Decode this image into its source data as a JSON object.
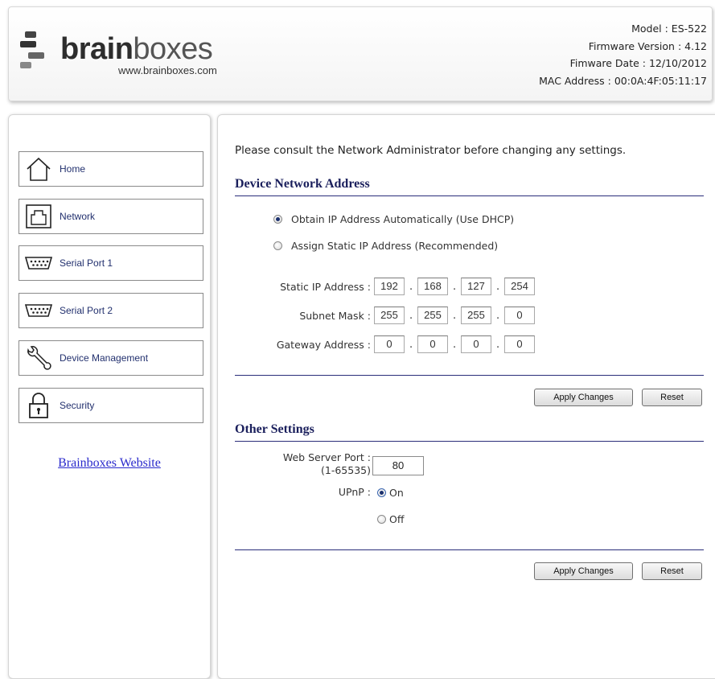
{
  "header": {
    "logo": {
      "brand_bold": "brain",
      "brand_light": "boxes",
      "url": "www.brainboxes.com"
    },
    "device_info": [
      {
        "label": "Model :",
        "value": "ES-522"
      },
      {
        "label": "Firmware Version :",
        "value": "4.12"
      },
      {
        "label": "Fimware Date :",
        "value": "12/10/2012"
      },
      {
        "label": "MAC Address :",
        "value": "00:0A:4F:05:11:17"
      }
    ]
  },
  "sidebar": {
    "items": [
      {
        "label": "Home",
        "icon": "home-icon"
      },
      {
        "label": "Network",
        "icon": "network-port-icon"
      },
      {
        "label": "Serial Port 1",
        "icon": "serial-port-icon"
      },
      {
        "label": "Serial Port 2",
        "icon": "serial-port-icon"
      },
      {
        "label": "Device Management",
        "icon": "wrench-icon"
      },
      {
        "label": "Security",
        "icon": "padlock-icon"
      }
    ],
    "website_link": "Brainboxes Website"
  },
  "main": {
    "notice": "Please consult the Network Administrator before changing any settings.",
    "network": {
      "title": "Device Network Address",
      "dhcp_label": "Obtain IP Address Automatically (Use DHCP)",
      "static_label": "Assign Static IP Address (Recommended)",
      "selected": "dhcp",
      "static_ip_label": "Static IP Address :",
      "static_ip": [
        "192",
        "168",
        "127",
        "254"
      ],
      "subnet_label": "Subnet Mask :",
      "subnet": [
        "255",
        "255",
        "255",
        "0"
      ],
      "gateway_label": "Gateway Address :",
      "gateway": [
        "0",
        "0",
        "0",
        "0"
      ],
      "dot": "."
    },
    "buttons": {
      "apply": "Apply Changes",
      "reset": "Reset"
    },
    "other": {
      "title": "Other Settings",
      "port_label": "Web Server Port :",
      "port_range": "(1-65535)",
      "port_value": "80",
      "upnp_label": "UPnP :",
      "upnp_on": "On",
      "upnp_off": "Off",
      "upnp_selected": "on"
    }
  },
  "colors": {
    "section_title": "#1a1f5c",
    "rule": "#2a2d7a",
    "link": "#2a2acc",
    "nav_text": "#22306e"
  }
}
